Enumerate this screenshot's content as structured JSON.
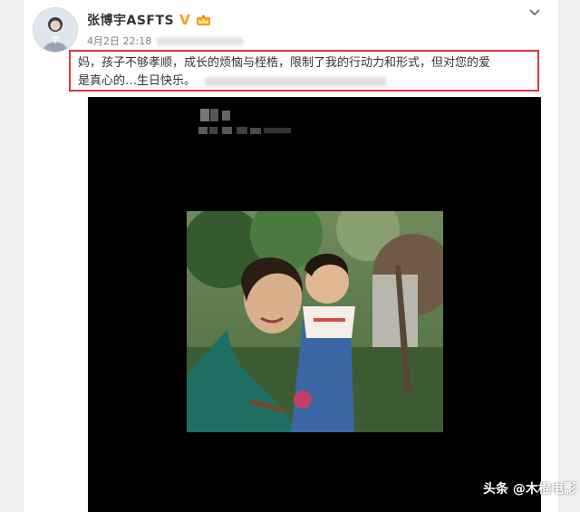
{
  "post": {
    "username": "张博宇ASFTS",
    "verified_badge": "V",
    "timestamp": "4月2日 22:18",
    "text_line1": "妈，孩子不够孝顺，成长的烦恼与桎梏，限制了我的行动力和形式，但对您的爱",
    "text_line2": "是真心的…生日快乐。"
  },
  "watermark": {
    "text": "头条 @木棍电影"
  },
  "icons": {
    "avatar": "avatar-icon",
    "crown": "crown-icon",
    "more": "chevron-down-icon"
  },
  "colors": {
    "highlight_border": "#d9363e",
    "verified": "#f0a30a",
    "media_background": "#000000"
  }
}
